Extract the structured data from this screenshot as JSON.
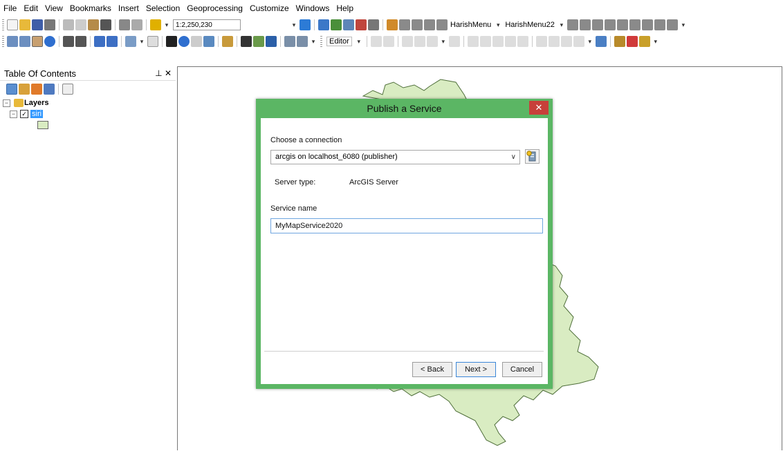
{
  "menu": {
    "items": [
      "File",
      "Edit",
      "View",
      "Bookmarks",
      "Insert",
      "Selection",
      "Geoprocessing",
      "Customize",
      "Windows",
      "Help"
    ]
  },
  "toolbar": {
    "scale": "1:2,250,230",
    "custom_menus": [
      "HarishMenu",
      "HarishMenu22"
    ],
    "editor_label": "Editor"
  },
  "toc": {
    "title": "Table Of Contents",
    "pin_glyph": " ✕",
    "root_label": "Layers",
    "layer_name": "siri",
    "layer_checked": true
  },
  "dialog": {
    "title": "Publish a Service",
    "close_glyph": "✕",
    "connection_label": "Choose a connection",
    "connection_value": "arcgis on localhost_6080 (publisher)",
    "server_type_label": "Server type:",
    "server_type_value": "ArcGIS Server",
    "service_name_label": "Service name",
    "service_name_value": "MyMapService2020",
    "buttons": {
      "back": "< Back",
      "next": "Next >",
      "cancel": "Cancel"
    }
  },
  "colors": {
    "dialog_frame": "#5bb664",
    "close_button": "#c7403a",
    "map_polygon_fill": "#d9ecc2",
    "map_polygon_stroke": "#4f6f3a",
    "selection": "#3399ff"
  }
}
